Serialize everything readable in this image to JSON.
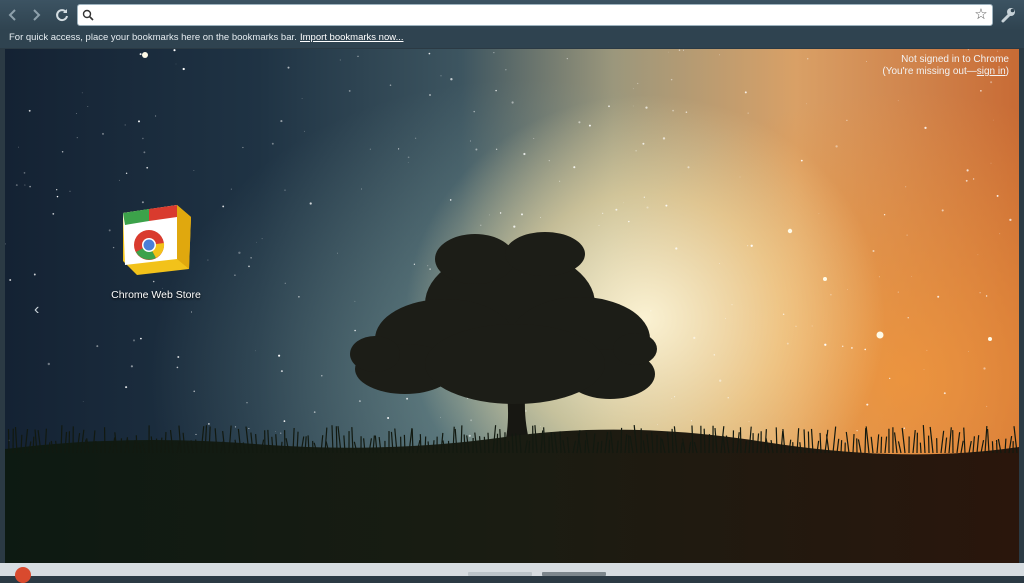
{
  "omnibox": {
    "value": "",
    "placeholder": ""
  },
  "bookmarks_bar": {
    "hint": "For quick access, place your bookmarks here on the bookmarks bar.",
    "import_link": "Import bookmarks now..."
  },
  "signin": {
    "line1": "Not signed in to Chrome",
    "line2_prefix": "(You're missing out—",
    "link": "sign in",
    "line2_suffix": ")"
  },
  "apps": [
    {
      "label": "Chrome Web Store",
      "icon": "chrome-web-store-icon"
    }
  ],
  "pager": {
    "pages": 2,
    "active_index": 1
  },
  "colors": {
    "toolbar": "#2f4350",
    "accent_link": "#ffffff"
  }
}
